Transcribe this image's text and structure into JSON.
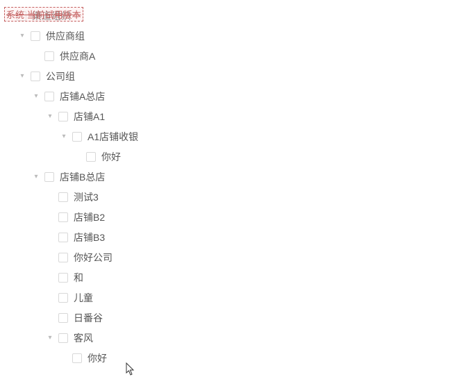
{
  "watermark": "系统 当前试用版本",
  "tree": [
    {
      "label": "渠道组织",
      "expanded": true,
      "children": [
        {
          "label": "供应商组",
          "expanded": true,
          "children": [
            {
              "label": "供应商A"
            }
          ]
        },
        {
          "label": "公司组",
          "expanded": true,
          "children": [
            {
              "label": "店铺A总店",
              "expanded": true,
              "children": [
                {
                  "label": "店铺A1",
                  "expanded": true,
                  "children": [
                    {
                      "label": "A1店铺收银",
                      "expanded": true,
                      "children": [
                        {
                          "label": "你好"
                        }
                      ]
                    }
                  ]
                }
              ]
            },
            {
              "label": "店铺B总店",
              "expanded": true,
              "children": [
                {
                  "label": "测试3"
                },
                {
                  "label": "店铺B2"
                },
                {
                  "label": "店铺B3"
                },
                {
                  "label": "你好公司"
                },
                {
                  "label": "和"
                },
                {
                  "label": "儿童"
                },
                {
                  "label": "日番谷"
                },
                {
                  "label": "客风",
                  "expanded": true,
                  "children": [
                    {
                      "label": "你好"
                    }
                  ]
                }
              ]
            }
          ]
        }
      ]
    }
  ]
}
